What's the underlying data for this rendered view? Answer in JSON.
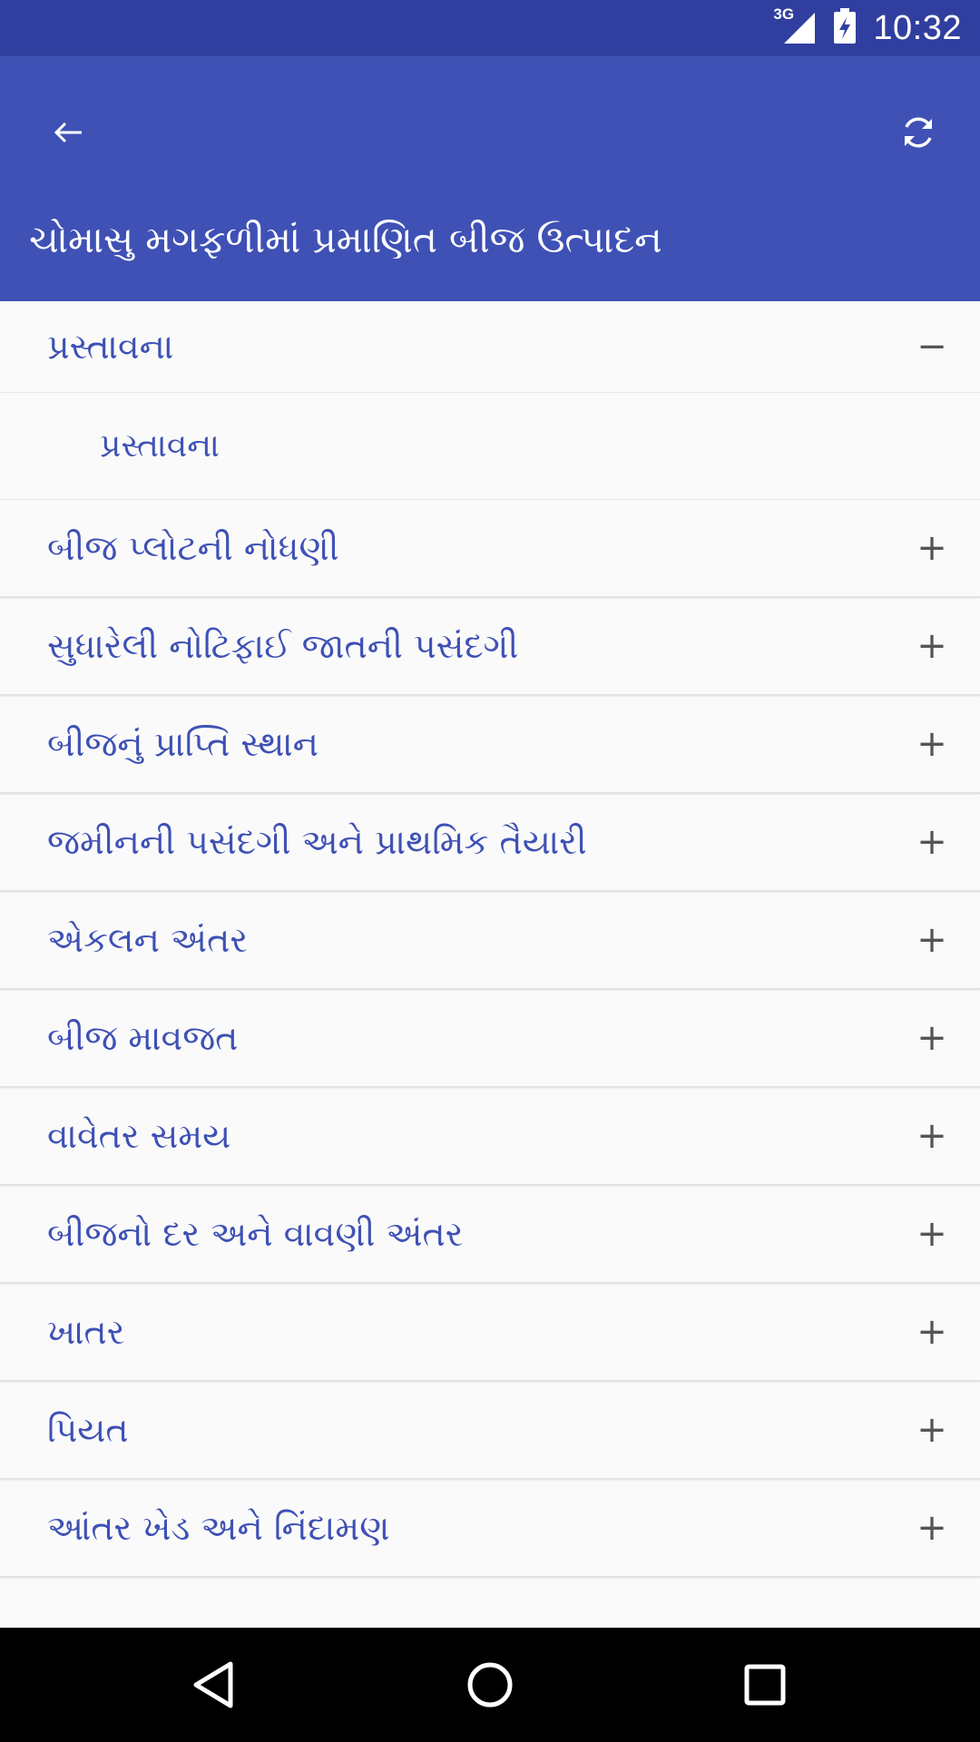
{
  "status_bar": {
    "network": "3G",
    "time": "10:32"
  },
  "toolbar": {
    "back_icon": "arrow-left-icon",
    "refresh_icon": "refresh-icon",
    "title": "ચોમાસુ મગફળીમાં પ્રમાણિત બીજ ઉત્પાદન"
  },
  "accordion": {
    "expanded": {
      "label": "પ્રસ્તાવના",
      "toggle": "−",
      "children": [
        {
          "label": "પ્રસ્તાવના"
        }
      ]
    },
    "items": [
      {
        "label": "બીજ પ્લોટની નોધણી",
        "toggle": "+"
      },
      {
        "label": "સુધારેલી નોટિફાઈ જાતની પસંદગી",
        "toggle": "+"
      },
      {
        "label": "બીજનું પ્રાપ્તિ સ્થાન",
        "toggle": "+"
      },
      {
        "label": "જમીનની પસંદગી અને પ્રાથમિક તૈયારી",
        "toggle": "+"
      },
      {
        "label": "એકલન અંતર",
        "toggle": "+"
      },
      {
        "label": "બીજ માવજત",
        "toggle": "+"
      },
      {
        "label": "વાવેતર સમય",
        "toggle": "+"
      },
      {
        "label": "બીજનો દર અને વાવણી અંતર",
        "toggle": "+"
      },
      {
        "label": "ખાતર",
        "toggle": "+"
      },
      {
        "label": "પિયત",
        "toggle": "+"
      },
      {
        "label": "આંતર ખેડ અને નિંદામણ",
        "toggle": "+"
      }
    ]
  },
  "colors": {
    "status_bar": "#303f9f",
    "app_bar": "#3f51b5",
    "accent_text": "#3f51b5"
  },
  "navigation": {
    "back_icon": "triangle-back-icon",
    "home_icon": "circle-home-icon",
    "recents_icon": "square-recents-icon"
  }
}
